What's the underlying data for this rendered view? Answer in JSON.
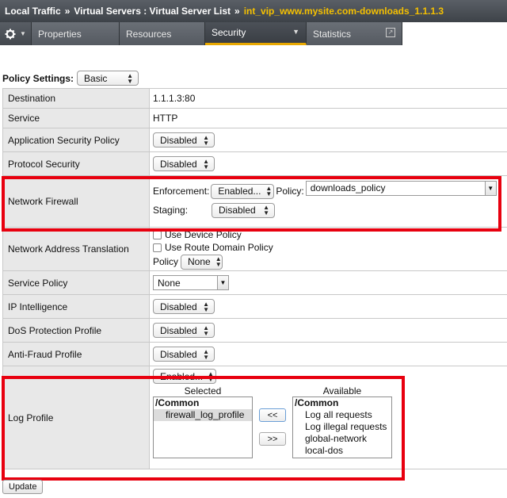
{
  "breadcrumb": {
    "items": [
      "Local Traffic",
      "Virtual Servers : Virtual Server List"
    ],
    "separator": "»",
    "current": "int_vip_www.mysite.com-downloads_1.1.1.3"
  },
  "tabs": {
    "gear_icon": "gear-icon",
    "items": [
      {
        "label": "Properties"
      },
      {
        "label": "Resources"
      },
      {
        "label": "Security"
      },
      {
        "label": "Statistics"
      }
    ]
  },
  "policy_settings": {
    "label": "Policy Settings:",
    "value": "Basic"
  },
  "rows": {
    "destination": {
      "label": "Destination",
      "value": "1.1.1.3:80"
    },
    "service": {
      "label": "Service",
      "value": "HTTP"
    },
    "asp": {
      "label": "Application Security Policy",
      "value": "Disabled"
    },
    "protocol_security": {
      "label": "Protocol Security",
      "value": "Disabled"
    },
    "network_firewall": {
      "label": "Network Firewall",
      "enforcement_label": "Enforcement:",
      "enforcement_value": "Enabled...",
      "policy_label": "Policy:",
      "policy_value": "downloads_policy",
      "staging_label": "Staging:",
      "staging_value": "Disabled"
    },
    "nat": {
      "label": "Network Address Translation",
      "use_device_policy": "Use Device Policy",
      "use_route_domain_policy": "Use Route Domain Policy",
      "policy_label": "Policy",
      "policy_value": "None"
    },
    "service_policy": {
      "label": "Service Policy",
      "value": "None"
    },
    "ip_intelligence": {
      "label": "IP Intelligence",
      "value": "Disabled"
    },
    "dos_profile": {
      "label": "DoS Protection Profile",
      "value": "Disabled"
    },
    "anti_fraud": {
      "label": "Anti-Fraud Profile",
      "value": "Disabled"
    },
    "log_profile": {
      "label": "Log Profile",
      "state": "Enabled...",
      "selected_label": "Selected",
      "available_label": "Available",
      "selected": {
        "group": "/Common",
        "items": [
          "firewall_log_profile"
        ]
      },
      "available": {
        "group": "/Common",
        "items": [
          "Log all requests",
          "Log illegal requests",
          "global-network",
          "local-dos"
        ]
      },
      "move_left": "<<",
      "move_right": ">>"
    }
  },
  "update_label": "Update",
  "colors": {
    "highlight": "#e8000f",
    "breadcrumb_current": "#f5c000",
    "active_tab_underline": "#e8a800"
  }
}
